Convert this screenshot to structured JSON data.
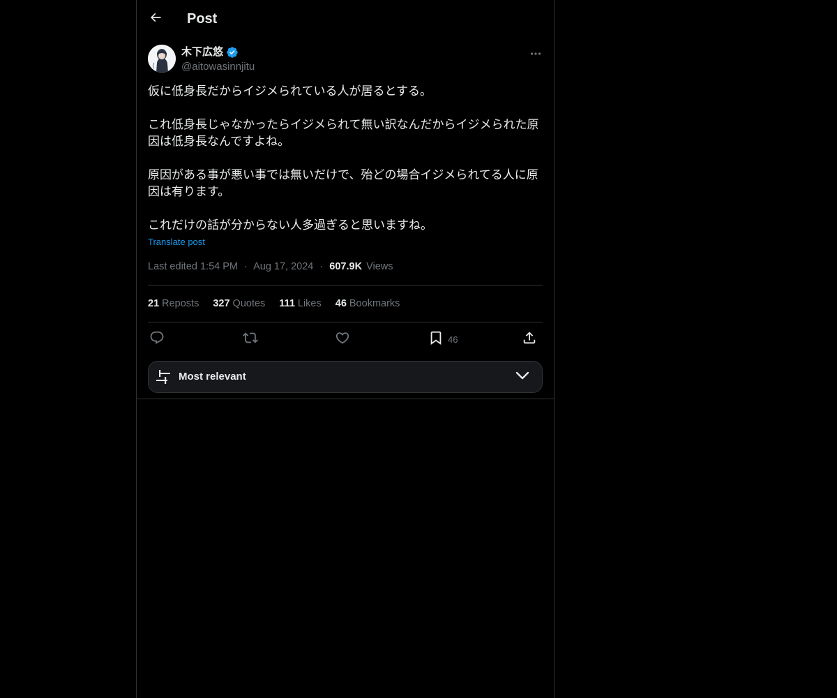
{
  "header": {
    "title": "Post",
    "back_icon": "arrow-left-icon"
  },
  "author": {
    "name": "木下広悠",
    "handle": "@aitowasinnjitu",
    "verified": true,
    "verified_color": "#1d9bf0"
  },
  "post": {
    "paragraphs": [
      "仮に低身長だからイジメられている人が居るとする。",
      "これ低身長じゃなかったらイジメられて無い訳なんだからイジメられた原因は低身長なんですよね。",
      "原因がある事が悪い事では無いだけで、殆どの場合イジメられてる人に原因は有ります。",
      "これだけの話が分からない人多過ぎると思いますね。"
    ],
    "translate_label": "Translate post"
  },
  "meta": {
    "edited": "Last edited 1:54 PM",
    "separator": "·",
    "date": "Aug 17, 2024",
    "views_count": "607.9K",
    "views_label": "Views"
  },
  "stats": [
    {
      "count": "21",
      "label": "Reposts"
    },
    {
      "count": "327",
      "label": "Quotes"
    },
    {
      "count": "111",
      "label": "Likes"
    },
    {
      "count": "46",
      "label": "Bookmarks"
    }
  ],
  "actions": {
    "bookmark_count": "46"
  },
  "sort": {
    "label": "Most relevant"
  },
  "colors": {
    "background": "#000000",
    "text": "#e7e9ea",
    "muted": "#71767b",
    "accent": "#1d9bf0",
    "border": "#2f3336"
  }
}
